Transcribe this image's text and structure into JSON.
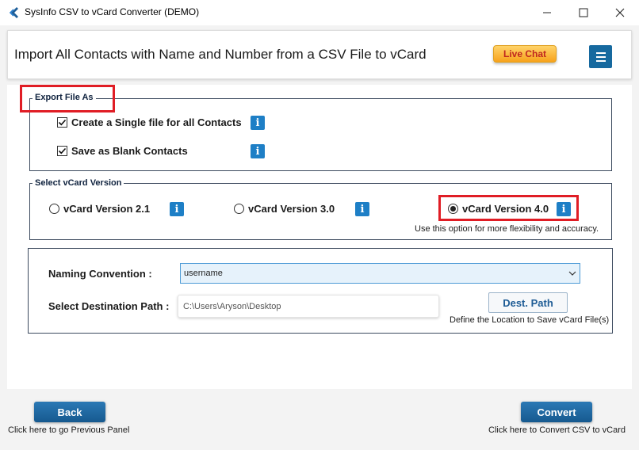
{
  "window": {
    "title": "SysInfo CSV to vCard Converter (DEMO)"
  },
  "header": {
    "title": "Import All Contacts with Name and Number from a CSV File to vCard",
    "live_chat_label": "Live Chat"
  },
  "export_group": {
    "legend": "Export File As",
    "options": [
      {
        "label": "Create a Single file for all Contacts",
        "checked": true
      },
      {
        "label": "Save as Blank Contacts",
        "checked": true
      }
    ]
  },
  "version_group": {
    "legend": "Select vCard Version",
    "options": [
      {
        "label": "vCard Version 2.1",
        "selected": false
      },
      {
        "label": "vCard Version 3.0",
        "selected": false
      },
      {
        "label": "vCard Version 4.0",
        "selected": true
      }
    ],
    "hint": "Use this option for more flexibility and accuracy."
  },
  "settings": {
    "naming_label": "Naming Convention :",
    "naming_value": "username",
    "dest_label": "Select Destination Path :",
    "dest_value": "C:\\Users\\Aryson\\Desktop",
    "dest_button": "Dest. Path",
    "dest_hint": "Define the Location to Save vCard File(s)"
  },
  "footer": {
    "back_label": "Back",
    "back_hint": "Click here to go Previous Panel",
    "convert_label": "Convert",
    "convert_hint": "Click here to Convert CSV to vCard"
  },
  "colors": {
    "accent": "#16699f",
    "highlight": "#e01d25",
    "live_chat": "#f7a21b",
    "info_icon": "#1e7fc6"
  },
  "icons": [
    "app-logo-icon",
    "minimize-icon",
    "maximize-icon",
    "close-icon",
    "hamburger-menu-icon",
    "info-icon",
    "checkbox-checked-icon",
    "radio-icon",
    "chevron-down-icon"
  ]
}
